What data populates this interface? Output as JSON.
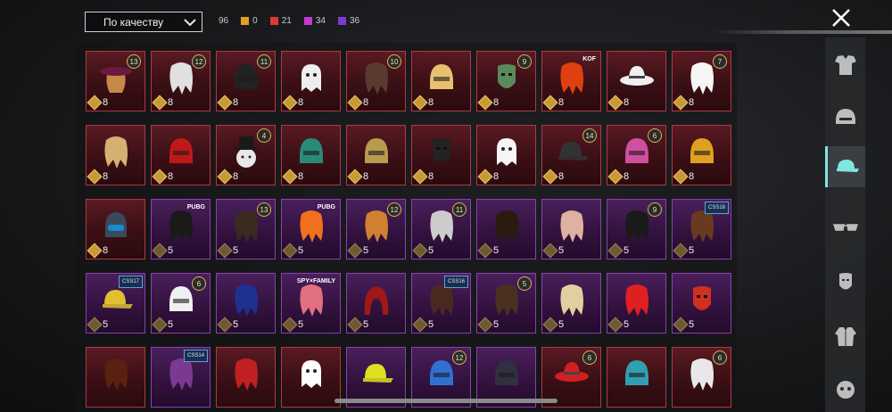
{
  "sort": {
    "label": "По качеству"
  },
  "counts": [
    {
      "value": "96",
      "color": null
    },
    {
      "value": "0",
      "color": "#e0a020"
    },
    {
      "value": "21",
      "color": "#d83a3a"
    },
    {
      "value": "34",
      "color": "#c23ad0"
    },
    {
      "value": "36",
      "color": "#7a3ad6"
    }
  ],
  "colors": {
    "red_frame": "#b23743",
    "purple_frame": "#8b3fb0",
    "active_accent": "#7fe6e0"
  },
  "items": [
    {
      "price": "8",
      "quality": "red",
      "badge": "13",
      "art": "hat-hair",
      "color": "#c58a4a"
    },
    {
      "price": "8",
      "quality": "red",
      "badge": "12",
      "art": "hair",
      "color": "#e0e0e0"
    },
    {
      "price": "8",
      "quality": "red",
      "badge": "11",
      "art": "helmet",
      "color": "#222222"
    },
    {
      "price": "8",
      "quality": "red",
      "badge": "",
      "art": "ghost",
      "color": "#eeeeee"
    },
    {
      "price": "8",
      "quality": "red",
      "badge": "10",
      "art": "hair",
      "color": "#5a3a30"
    },
    {
      "price": "8",
      "quality": "red",
      "badge": "",
      "art": "helmet",
      "color": "#e8c070"
    },
    {
      "price": "8",
      "quality": "red",
      "badge": "9",
      "art": "mask",
      "color": "#5a8a5a"
    },
    {
      "price": "8",
      "quality": "red",
      "badge": "",
      "tag": "KOF",
      "art": "hair",
      "color": "#e04010"
    },
    {
      "price": "8",
      "quality": "red",
      "badge": "",
      "art": "hat",
      "color": "#f0f0f0"
    },
    {
      "price": "8",
      "quality": "red",
      "badge": "7",
      "art": "hair",
      "color": "#f5f5f5"
    },
    {
      "price": "8",
      "quality": "red",
      "badge": "",
      "art": "hair",
      "color": "#d6b070"
    },
    {
      "price": "8",
      "quality": "red",
      "badge": "",
      "art": "helmet",
      "color": "#c01818"
    },
    {
      "price": "8",
      "quality": "red",
      "badge": "4",
      "art": "snowman",
      "color": "#e8e8e8"
    },
    {
      "price": "8",
      "quality": "red",
      "badge": "",
      "art": "helmet",
      "color": "#2a8a7a"
    },
    {
      "price": "8",
      "quality": "red",
      "badge": "",
      "art": "helmet",
      "color": "#b89a50"
    },
    {
      "price": "8",
      "quality": "red",
      "badge": "",
      "art": "mask",
      "color": "#222222"
    },
    {
      "price": "8",
      "quality": "red",
      "badge": "",
      "art": "ghost",
      "color": "#f5f5f5"
    },
    {
      "price": "8",
      "quality": "red",
      "badge": "14",
      "art": "cap",
      "color": "#333333"
    },
    {
      "price": "8",
      "quality": "red",
      "badge": "6",
      "art": "helmet",
      "color": "#d04fa0"
    },
    {
      "price": "8",
      "quality": "red",
      "badge": "",
      "art": "helmet",
      "color": "#e0a020"
    },
    {
      "price": "8",
      "quality": "red",
      "badge": "",
      "art": "gasmask",
      "color": "#3a4a5a"
    },
    {
      "price": "5",
      "quality": "purple",
      "badge": "",
      "tag": "PUBG",
      "art": "hair",
      "color": "#1a1a1a"
    },
    {
      "price": "5",
      "quality": "purple",
      "badge": "13",
      "art": "hair",
      "color": "#3a2a20"
    },
    {
      "price": "5",
      "quality": "purple",
      "badge": "",
      "tag": "PUBG",
      "art": "hair",
      "color": "#f07020"
    },
    {
      "price": "5",
      "quality": "purple",
      "badge": "12",
      "art": "hair",
      "color": "#d08030"
    },
    {
      "price": "5",
      "quality": "purple",
      "badge": "11",
      "art": "hair",
      "color": "#cccccc"
    },
    {
      "price": "5",
      "quality": "purple",
      "badge": "",
      "art": "hair",
      "color": "#2a1a10"
    },
    {
      "price": "5",
      "quality": "purple",
      "badge": "",
      "art": "hair",
      "color": "#e0b0a0"
    },
    {
      "price": "5",
      "quality": "purple",
      "badge": "9",
      "art": "hair",
      "color": "#1a1a1a"
    },
    {
      "price": "5",
      "quality": "purple",
      "badge": "",
      "tag": "CSS18",
      "art": "hair",
      "color": "#6a3a20"
    },
    {
      "price": "5",
      "quality": "purple",
      "badge": "",
      "tag": "CSS17",
      "art": "cap",
      "color": "#e0c030"
    },
    {
      "price": "5",
      "quality": "purple",
      "badge": "6",
      "art": "helmet",
      "color": "#f0f0f0"
    },
    {
      "price": "5",
      "quality": "purple",
      "badge": "",
      "art": "hair",
      "color": "#203090"
    },
    {
      "price": "5",
      "quality": "purple",
      "badge": "",
      "tag": "SPY×FAMILY",
      "art": "hair",
      "color": "#e07080"
    },
    {
      "price": "5",
      "quality": "purple",
      "badge": "",
      "art": "hood",
      "color": "#a01818"
    },
    {
      "price": "5",
      "quality": "purple",
      "badge": "",
      "tag": "CSS16",
      "art": "hair",
      "color": "#4a2a20"
    },
    {
      "price": "5",
      "quality": "purple",
      "badge": "5",
      "art": "hair",
      "color": "#4a3020"
    },
    {
      "price": "5",
      "quality": "purple",
      "badge": "",
      "art": "hair",
      "color": "#e0d0a0"
    },
    {
      "price": "5",
      "quality": "purple",
      "badge": "",
      "art": "hair",
      "color": "#e02020"
    },
    {
      "price": "5",
      "quality": "purple",
      "badge": "",
      "art": "mask",
      "color": "#d03020"
    },
    {
      "price": "",
      "quality": "red",
      "badge": "",
      "tag": "",
      "art": "hair",
      "color": "#5a2010"
    },
    {
      "price": "",
      "quality": "purple",
      "badge": "",
      "tag": "CSS14",
      "art": "hair",
      "color": "#7a3a90"
    },
    {
      "price": "",
      "quality": "red",
      "badge": "",
      "art": "hair",
      "color": "#c02020"
    },
    {
      "price": "",
      "quality": "red",
      "badge": "",
      "art": "ghost",
      "color": "#ffffff"
    },
    {
      "price": "",
      "quality": "purple",
      "badge": "",
      "art": "cap",
      "color": "#e0e020"
    },
    {
      "price": "",
      "quality": "purple",
      "badge": "12",
      "art": "helmet",
      "color": "#3070d0"
    },
    {
      "price": "",
      "quality": "purple",
      "badge": "",
      "art": "helmet",
      "color": "#303040"
    },
    {
      "price": "",
      "quality": "red",
      "badge": "6",
      "art": "hat",
      "color": "#d02020"
    },
    {
      "price": "",
      "quality": "red",
      "badge": "",
      "art": "helmet",
      "color": "#30a0b0"
    },
    {
      "price": "",
      "quality": "red",
      "badge": "6",
      "art": "hair",
      "color": "#e8e8e8"
    }
  ]
}
